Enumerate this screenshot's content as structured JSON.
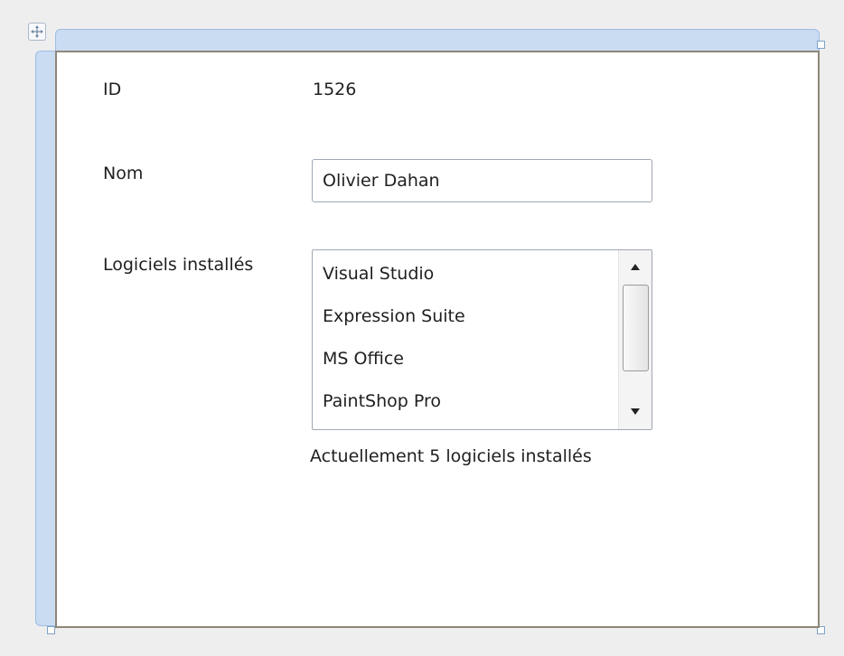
{
  "form": {
    "id_label": "ID",
    "id_value": "1526",
    "name_label": "Nom",
    "name_value": "Olivier Dahan",
    "software_label": "Logiciels installés",
    "software_items": [
      "Visual Studio",
      "Expression Suite",
      "MS Office",
      "PaintShop Pro"
    ],
    "software_count_text": "Actuellement 5 logiciels installés"
  },
  "icons": {
    "move_handle": "move-icon",
    "scroll_up": "scroll-up-arrow-icon",
    "scroll_down": "scroll-down-arrow-icon"
  },
  "colors": {
    "adorner": "#c9dcf2",
    "frame_border": "#8f8678"
  }
}
